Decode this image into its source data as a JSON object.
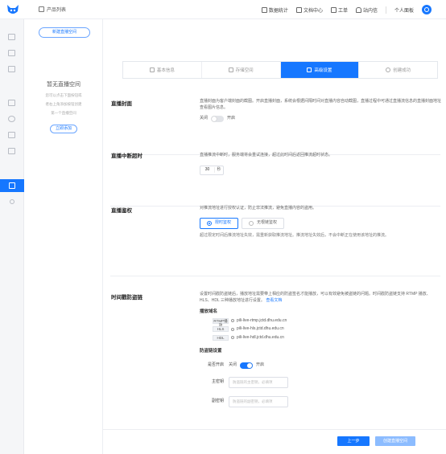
{
  "topbar": {
    "breadcrumb": "产品列表",
    "nav": [
      "数据统计",
      "文档中心",
      "工单",
      "站内信"
    ],
    "user": "个人面板"
  },
  "col2": {
    "new_space_button": "新建直播空间",
    "empty_title": "暂无直播空间",
    "empty_desc": [
      "您可以点击下面按钮或",
      "者右上角添加按钮创建",
      "第一个直播空间"
    ],
    "add_now_button": "立即添加"
  },
  "steps": [
    {
      "label": "基本信息",
      "icon": "info-icon"
    },
    {
      "label": "存储空间",
      "icon": "storage-icon"
    },
    {
      "label": "高级设置",
      "icon": "settings-icon",
      "active": true
    },
    {
      "label": "创建成功",
      "icon": "check-icon"
    }
  ],
  "cover": {
    "title": "直播封面",
    "desc": "直播封面为客户端封面的截图。开启直播封面，系统会根据间隔时间对直播内容自动截图，直播过程中可通过直播流信息的直播封面地址查看图片信息。",
    "off_label": "关闭",
    "on_label": "开启",
    "enabled": false
  },
  "timeout": {
    "title": "直播中断超时",
    "desc": "直播推流中断时，服务端将会重试连接，超过此时间后返回推流超时状态。",
    "value": "30",
    "unit": "秒"
  },
  "auth": {
    "title": "直播鉴权",
    "desc": "对推流地址进行授权认证，防止非法推流，避免直播内容的盗用。",
    "options": [
      "限时鉴权",
      "无根链鉴权"
    ],
    "selected": 0,
    "note": "超过限定时间后推流地址失效，需重新获取推流地址。推流地址失效后，不会中断正在使用该地址的推流。"
  },
  "anti_leech": {
    "title": "时间戳防盗链",
    "desc": "设置时间戳防盗链后，播放地址需要带上相应的防盗签名才能播放，可以有效避免被盗链的问题。时间戳防盗链支持 RTMP 播放、HLS、HDL 三种播放地址进行设置。",
    "doc_link": "查看文档",
    "domains_title": "播放域名",
    "domains": [
      {
        "tag": "RTMP播放",
        "host": "pili-live-rtmp.jctd.dhu.edu.cn"
      },
      {
        "tag": "HLS",
        "host": "pili-live-hls.jctd.dhu.edu.cn"
      },
      {
        "tag": "HDL",
        "host": "pili-live-hdl.jctd.dhu.edu.cn"
      }
    ],
    "settings_title": "防盗链设置",
    "enable_label": "是否开启",
    "off_label": "关闭",
    "on_label": "开启",
    "enabled": true,
    "primary_key_label": "主密钥",
    "primary_key_placeholder": "防盗链的主密钥，必填项",
    "secondary_key_label": "副密钥",
    "secondary_key_placeholder": "防盗链的副密钥，必填项"
  },
  "footer": {
    "prev_button": "上一步",
    "create_button": "创建直播空间"
  },
  "colors": {
    "accent": "#1677ff",
    "accent_disabled": "#8cbcff"
  }
}
